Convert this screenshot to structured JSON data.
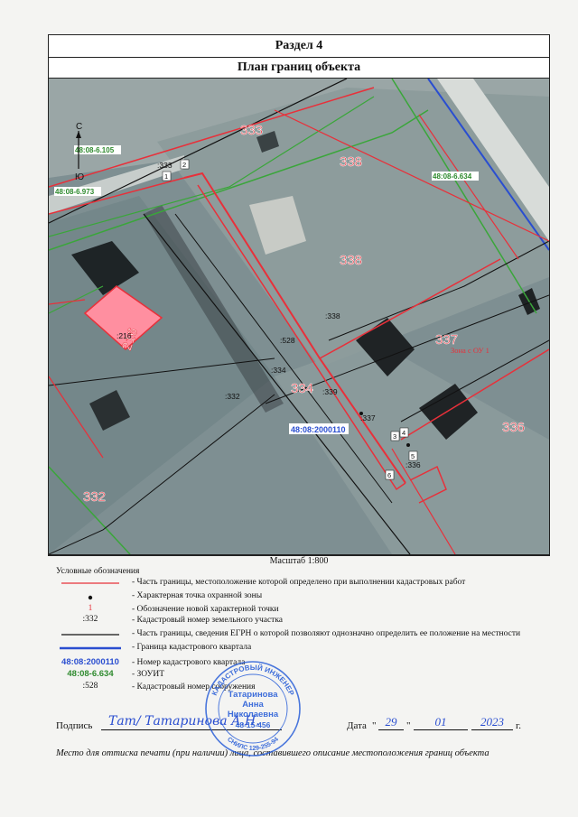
{
  "section_title": "Раздел 4",
  "plan_title": "План границ объекта",
  "map": {
    "parcels": {
      "p333": "333",
      "p338a": "338",
      "p338b": "338",
      "p337": "337",
      "p336": "336",
      "p334": "334",
      "p216": "216",
      "p332": "332"
    },
    "cadastral_labels": {
      "c333": ":333",
      "c338": ":338",
      "c528": ":528",
      "c334": ":334",
      "c332": ":332",
      "c339": ":339",
      "c337": ":337",
      "c336": ":336",
      "c216": ":216"
    },
    "points": {
      "pt1": "1",
      "pt2": "2",
      "pt3": "3",
      "pt4": "4",
      "pt5": "5",
      "pt6": "6"
    },
    "zouit": {
      "z105": "48:08-6.105",
      "z973": "48:08-6.973",
      "z634": "48:08-6.634"
    },
    "quarter_label": "48:08:2000110",
    "zone_label": "Зона с ОУ 1",
    "compass_n": "С",
    "compass_s": "Ю"
  },
  "scale": "Масштаб 1:800",
  "legend": {
    "title": "Условные обозначения",
    "items": [
      {
        "symbol": "",
        "text": "- Часть границы, местоположение которой определено при выполнении кадастровых работ"
      },
      {
        "symbol": "",
        "text": "- Характерная точка охранной зоны"
      },
      {
        "symbol": "1",
        "text": "- Обозначение новой характерной точки"
      },
      {
        "symbol": ":332",
        "text": "- Кадастровый номер земельного участка"
      },
      {
        "symbol": "",
        "text": "- Часть границы, сведения ЕГРН о которой позволяют однозначно определить ее положение на местности"
      },
      {
        "symbol": "",
        "text": "- Граница кадастрового квартала"
      },
      {
        "symbol": "48:08:2000110",
        "text": "- Номер кадастрового квартала"
      },
      {
        "symbol": "48:08-6.634",
        "text": "- ЗОУИТ"
      },
      {
        "symbol": ":528",
        "text": "- Кадастровый номер сооружения"
      }
    ]
  },
  "signature": {
    "label": "Подпись",
    "handwritten": "Тат/ Татаринова А.Н.",
    "date_label": "Дата",
    "day": "29",
    "month": "01",
    "year": "2023",
    "year_suffix": "г."
  },
  "stamp": {
    "top_text": "КАДАСТРОВЫЙ ИНЖЕНЕР",
    "line1": "Татаринова",
    "line2": "Анна",
    "line3": "Николаевна",
    "number": "48-15-456",
    "bottom_text": "СНИЛС 129-255-94"
  },
  "footer": "Место для оттиска печати (при наличии) лица, составившего описание местоположения границ объекта",
  "colors": {
    "red": "#e8303a",
    "green": "#3aa63a",
    "blue": "#2a4ed0",
    "stamp": "#2a5fd8"
  }
}
